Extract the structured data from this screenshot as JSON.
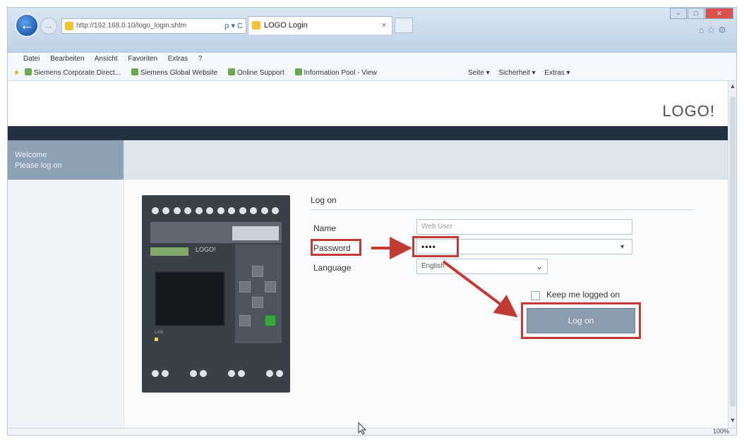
{
  "browser": {
    "address": "http://192.168.0.10/logo_login.shtm",
    "address_tools": "ρ ▾ C",
    "tab_title": "LOGO Login",
    "tab_close": "×",
    "back_icon": "←",
    "forward_icon": "→"
  },
  "menubar": {
    "items": [
      "Datei",
      "Bearbeiten",
      "Ansicht",
      "Favoriten",
      "Extras",
      "?"
    ]
  },
  "favorites": {
    "items": [
      "Siemens Corporate Direct...",
      "Siemens Global Website",
      "Online Support",
      "Information Pool - View"
    ],
    "commands": [
      "Seite ▾",
      "Sicherheit ▾",
      "Extras ▾"
    ]
  },
  "page": {
    "brand": "LOGO!",
    "side_welcome": "Welcome",
    "side_prompt": "Please log on"
  },
  "device": {
    "brand": "LOGO!",
    "led_label": "LAN"
  },
  "login": {
    "title": "Log on",
    "name_label": "Name",
    "name_placeholder": "Web User",
    "password_label": "Password",
    "password_value": "••••",
    "language_label": "Language",
    "language_value": "English",
    "keep_logged_label": "Keep me logged on",
    "login_button": "Log on"
  },
  "statusbar": {
    "zoom": "100%"
  },
  "colors": {
    "highlight": "#c23a34",
    "navbar": "#23303f",
    "button": "#8a9cae"
  }
}
